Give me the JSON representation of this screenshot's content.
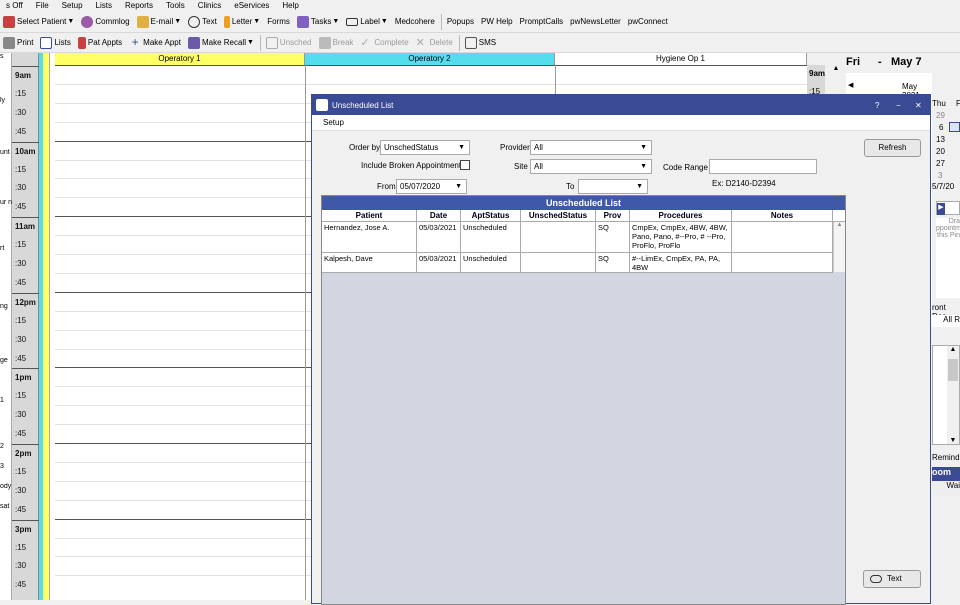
{
  "menubar": [
    "s Off",
    "File",
    "Setup",
    "Lists",
    "Reports",
    "Tools",
    "Clinics",
    "eServices",
    "Help"
  ],
  "toolbar1": {
    "select_patient": "Select Patient",
    "commlog": "Commlog",
    "email": "E-mail",
    "text": "Text",
    "letter": "Letter",
    "forms": "Forms",
    "tasks": "Tasks",
    "label": "Label",
    "medcohere": "Medcohere",
    "popups": "Popups",
    "pw_help": "PW Help",
    "prompt_calls": "PromptCalls",
    "pw_news_letter": "pwNewsLetter",
    "pw_connect": "pwConnect"
  },
  "toolbar2": {
    "print": "Print",
    "lists": "Lists",
    "pat_appts": "Pat Appts",
    "make_appt": "Make Appt",
    "make_recall": "Make Recall",
    "unsched": "Unsched",
    "break": "Break",
    "complete": "Complete",
    "delete": "Delete",
    "sms": "SMS"
  },
  "left_strip": [
    "s",
    "ly",
    "unt",
    "ur n",
    "rt",
    "ng",
    "ge",
    "1",
    "2",
    "3",
    "ody",
    "sat"
  ],
  "times": [
    {
      "label": "9am",
      "hour": true
    },
    {
      "label": ":15"
    },
    {
      "label": ":30"
    },
    {
      "label": ":45"
    },
    {
      "label": "10am",
      "hour": true
    },
    {
      "label": ":15"
    },
    {
      "label": ":30"
    },
    {
      "label": ":45"
    },
    {
      "label": "11am",
      "hour": true
    },
    {
      "label": ":15"
    },
    {
      "label": ":30"
    },
    {
      "label": ":45"
    },
    {
      "label": "12pm",
      "hour": true
    },
    {
      "label": ":15"
    },
    {
      "label": ":30"
    },
    {
      "label": ":45"
    },
    {
      "label": "1pm",
      "hour": true
    },
    {
      "label": ":15"
    },
    {
      "label": ":30"
    },
    {
      "label": ":45"
    },
    {
      "label": "2pm",
      "hour": true
    },
    {
      "label": ":15"
    },
    {
      "label": ":30"
    },
    {
      "label": ":45"
    },
    {
      "label": "3pm",
      "hour": true
    },
    {
      "label": ":15"
    },
    {
      "label": ":30"
    },
    {
      "label": ":45"
    }
  ],
  "operatories": [
    "Operatory 1",
    "Operatory 2",
    "Hygiene Op 1"
  ],
  "right_times": [
    "9am",
    ":15"
  ],
  "calendar": {
    "day": "Fri",
    "dash": "-",
    "date": "May 7",
    "month": "May 2021",
    "prev": "◀",
    "dow": [
      "Thu",
      "F"
    ],
    "days": [
      "29",
      "6",
      "13",
      "20",
      "27",
      "3"
    ],
    "footer_date": "5/7/20",
    "note_lines": [
      "Dra",
      "ppointm",
      "this Pin"
    ],
    "front_desk": "ront Des",
    "all_label": "All R",
    "remind": "Remind",
    "room_tab": "oom",
    "wait": "Wai"
  },
  "dialog": {
    "title": "Unscheduled List",
    "help": "?",
    "minimize": "−",
    "close": "✕",
    "menu_setup": "Setup",
    "order_by_label": "Order by",
    "order_by_value": "UnschedStatus",
    "include_broken_label": "Include Broken Appointments",
    "from_label": "From",
    "from_value": "05/07/2020",
    "provider_label": "Provider",
    "provider_value": "All",
    "site_label": "Site",
    "site_value": "All",
    "to_label": "To",
    "to_value": "",
    "code_range_label": "Code Range",
    "code_range_value": "",
    "code_range_example": "Ex: D2140-D2394",
    "refresh": "Refresh",
    "text_button": "Text",
    "grid_title": "Unscheduled List",
    "columns": [
      "Patient",
      "Date",
      "AptStatus",
      "UnschedStatus",
      "Prov",
      "Procedures",
      "Notes"
    ],
    "rows": [
      {
        "patient": "Hernandez, Jose A.",
        "date": "05/03/2021",
        "apt_status": "Unscheduled",
        "unsched_status": "",
        "prov": "SQ",
        "procedures": "CmpEx, CmpEx, 4BW, 4BW, Pano, Pano, #--Pro, # --Pro, ProFlo, ProFlo",
        "notes": ""
      },
      {
        "patient": "Kalpesh, Dave",
        "date": "05/03/2021",
        "apt_status": "Unscheduled",
        "unsched_status": "",
        "prov": "SQ",
        "procedures": "#--LimEx, CmpEx, PA, PA, 4BW",
        "notes": ""
      }
    ]
  },
  "colors": {
    "accent": "#3b4a94",
    "grid_title": "#3f58a8",
    "op1": "#ffff66",
    "op2": "#55ddee"
  }
}
